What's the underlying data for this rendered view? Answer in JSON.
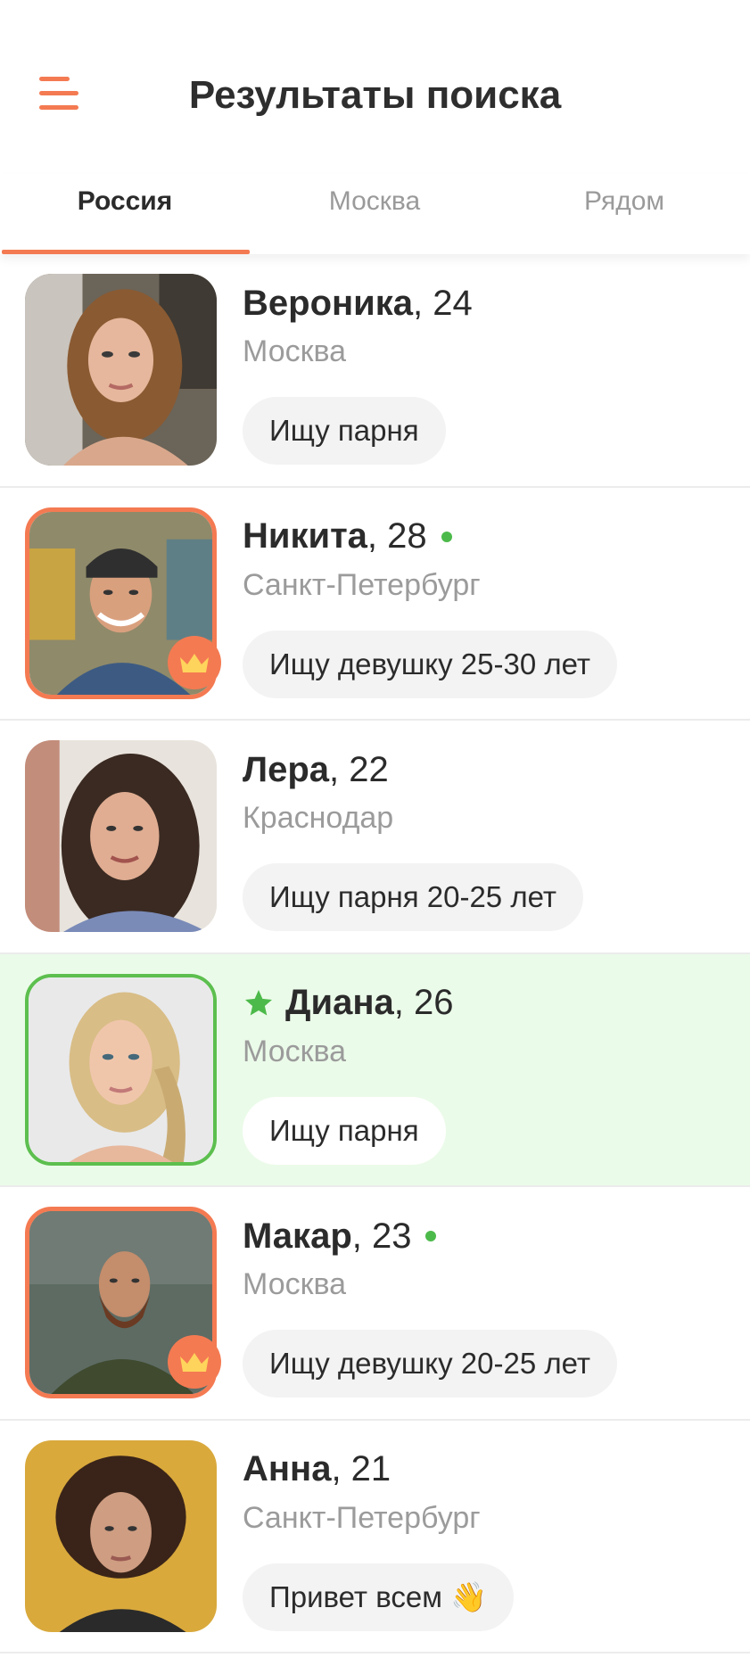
{
  "header": {
    "title": "Результаты поиска",
    "menu_icon": "hamburger-menu-icon"
  },
  "tabs": [
    {
      "label": "Россия",
      "active": true
    },
    {
      "label": "Москва",
      "active": false
    },
    {
      "label": "Рядом",
      "active": false
    }
  ],
  "colors": {
    "accent": "#f47a52",
    "online": "#4cba4a",
    "featured_bg": "#ebfbe9",
    "featured_border": "#5cbf4e"
  },
  "profiles": [
    {
      "name": "Вероника",
      "age": ", 24",
      "city": "Москва",
      "status": "Ищу парня",
      "online": false,
      "premium": false,
      "featured": false
    },
    {
      "name": "Никита",
      "age": ", 28",
      "city": "Санкт-Петербург",
      "status": "Ищу девушку 25-30 лет",
      "online": true,
      "premium": true,
      "featured": false
    },
    {
      "name": "Лера",
      "age": ", 22",
      "city": "Краснодар",
      "status": "Ищу парня 20-25 лет",
      "online": false,
      "premium": false,
      "featured": false
    },
    {
      "name": "Диана",
      "age": ", 26",
      "city": "Москва",
      "status": "Ищу парня",
      "online": false,
      "premium": false,
      "featured": true
    },
    {
      "name": "Макар",
      "age": ", 23",
      "city": "Москва",
      "status": "Ищу девушку 20-25 лет",
      "online": true,
      "premium": true,
      "featured": false
    },
    {
      "name": "Анна",
      "age": ", 21",
      "city": "Санкт-Петербург",
      "status": "Привет всем 👋",
      "online": false,
      "premium": false,
      "featured": false
    }
  ]
}
